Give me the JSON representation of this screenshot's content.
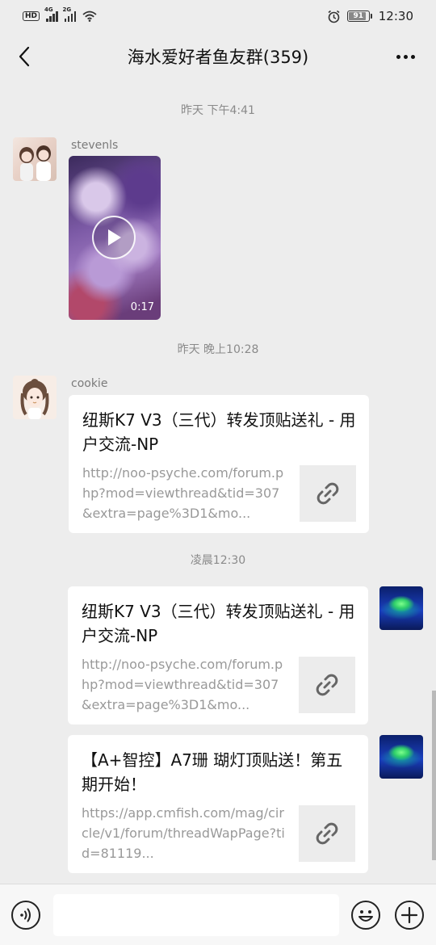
{
  "status_bar": {
    "hd_label": "HD",
    "sim1_network": "4G",
    "sim2_network": "2G",
    "battery_level": "91",
    "time": "12:30",
    "icons": [
      "hd-voice-icon",
      "signal-icon",
      "wifi-icon",
      "alarm-icon",
      "battery-icon"
    ]
  },
  "nav": {
    "title": "海水爱好者鱼友群(359)",
    "back_icon": "chevron-left-icon",
    "more_icon": "more-icon"
  },
  "messages": [
    {
      "type": "timestamp",
      "text": "昨天 下午4:41"
    },
    {
      "type": "video",
      "sender": "stevenls",
      "duration": "0:17"
    },
    {
      "type": "timestamp",
      "text": "昨天 晚上10:28"
    },
    {
      "type": "link",
      "sender": "cookie",
      "title": "纽斯K7 V3（三代）转发顶贴送礼 - 用户交流-NP",
      "url": "http://noo-psyche.com/forum.php?mod=viewthread&tid=307&extra=page%3D1&mo..."
    },
    {
      "type": "timestamp",
      "text": "凌晨12:30"
    },
    {
      "type": "link",
      "sender": "self",
      "title": "纽斯K7 V3（三代）转发顶贴送礼 - 用户交流-NP",
      "url": "http://noo-psyche.com/forum.php?mod=viewthread&tid=307&extra=page%3D1&mo..."
    },
    {
      "type": "link",
      "sender": "self",
      "title": "【A+智控】A7珊 瑚灯顶贴送！第五期开始！",
      "url": "https://app.cmfish.com/mag/circle/v1/forum/threadWapPage?tid=81119..."
    }
  ],
  "input_bar": {
    "voice_icon": "voice-icon",
    "emoji_icon": "emoji-icon",
    "plus_icon": "plus-icon"
  },
  "colors": {
    "background": "#ededed",
    "bubble": "#ffffff",
    "timestamp_text": "#8a8a8a",
    "url_text": "#999999"
  }
}
